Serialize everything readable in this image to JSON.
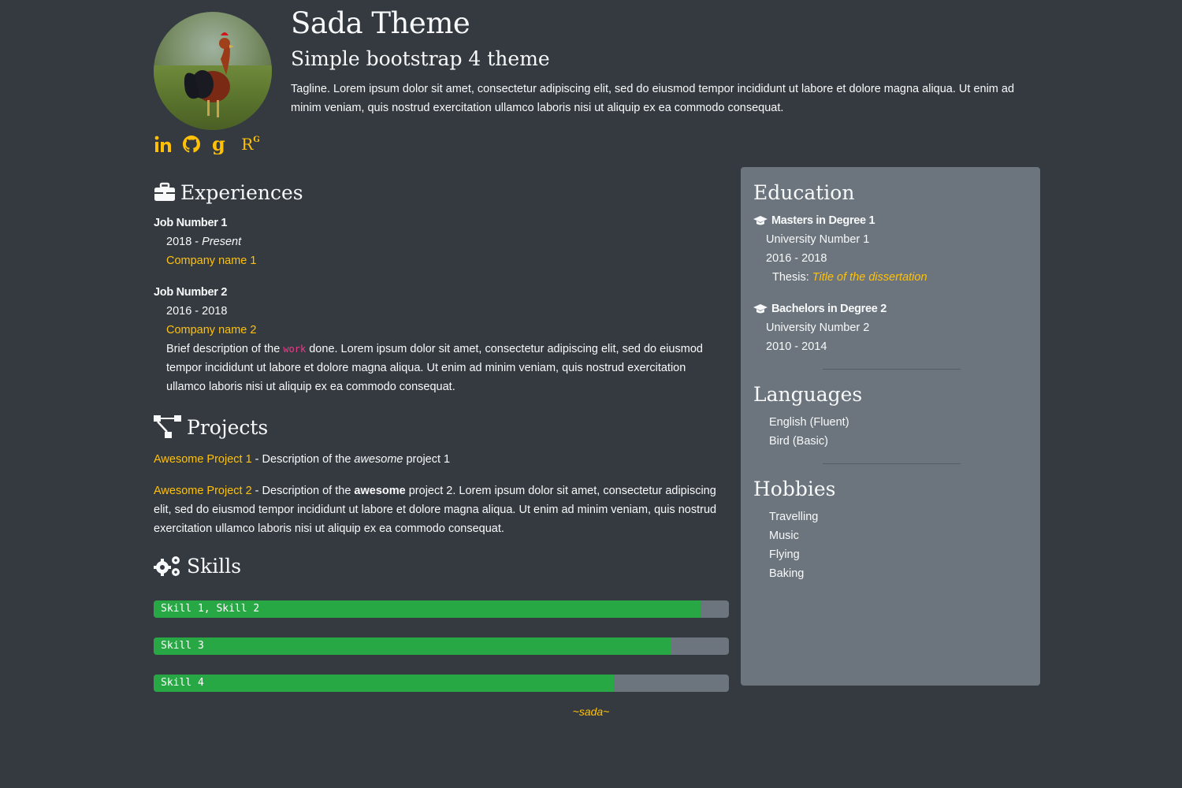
{
  "header": {
    "title": "Sada Theme",
    "subtitle": "Simple bootstrap 4 theme",
    "tagline": "Tagline. Lorem ipsum dolor sit amet, consectetur adipiscing elit, sed do eiusmod tempor incididunt ut labore et dolore magna aliqua. Ut enim ad minim veniam, quis nostrud exercitation ullamco laboris nisi ut aliquip ex ea commodo consequat.",
    "socials": [
      "linkedin-icon",
      "github-icon",
      "google-scholar-icon",
      "researchgate-icon"
    ],
    "researchgate_label": "R",
    "researchgate_sup": "G"
  },
  "experiences": {
    "heading": "Experiences",
    "jobs": [
      {
        "title": "Job Number 1",
        "start": "2018 - ",
        "end": "Present",
        "company": "Company name 1"
      },
      {
        "title": "Job Number 2",
        "dates": "2016 - 2018",
        "company": "Company name 2",
        "desc_before": "Brief description of the ",
        "desc_code": "work",
        "desc_after": " done. Lorem ipsum dolor sit amet, consectetur adipiscing elit, sed do eiusmod tempor incididunt ut labore et dolore magna aliqua. Ut enim ad minim veniam, quis nostrud exercitation ullamco laboris nisi ut aliquip ex ea commodo consequat."
      }
    ]
  },
  "projects": {
    "heading": "Projects",
    "items": [
      {
        "name": "Awesome Project 1",
        "sep": " - Description of the ",
        "emph": "awesome",
        "rest": " project 1"
      },
      {
        "name": "Awesome Project 2",
        "sep": " - Description of the ",
        "emph": "awesome",
        "rest": " project 2. Lorem ipsum dolor sit amet, consectetur adipiscing elit, sed do eiusmod tempor incididunt ut labore et dolore magna aliqua. Ut enim ad minim veniam, quis nostrud exercitation ullamco laboris nisi ut aliquip ex ea commodo consequat."
      }
    ]
  },
  "skills": {
    "heading": "Skills",
    "items": [
      {
        "label": "Skill 1, Skill 2",
        "level": 0.95
      },
      {
        "label": "Skill 3",
        "level": 0.9
      },
      {
        "label": "Skill 4",
        "level": 0.8
      }
    ],
    "fill_color": "#28a745",
    "track_color": "#6c757d"
  },
  "education": {
    "heading": "Education",
    "degrees": [
      {
        "title": "Masters in Degree 1",
        "school": "University Number 1",
        "dates": "2016 - 2018",
        "thesis_label": "Thesis: ",
        "thesis_title": "Title of the dissertation"
      },
      {
        "title": "Bachelors in Degree 2",
        "school": "University Number 2",
        "dates": "2010 - 2014"
      }
    ]
  },
  "languages": {
    "heading": "Languages",
    "items": [
      "English (Fluent)",
      "Bird (Basic)"
    ]
  },
  "hobbies": {
    "heading": "Hobbies",
    "items": [
      "Travelling",
      "Music",
      "Flying",
      "Baking"
    ]
  },
  "footer": "~sada~",
  "colors": {
    "background": "#343a40",
    "accent": "#ffc107",
    "panel": "#6c757d",
    "code": "#e83e8c"
  }
}
